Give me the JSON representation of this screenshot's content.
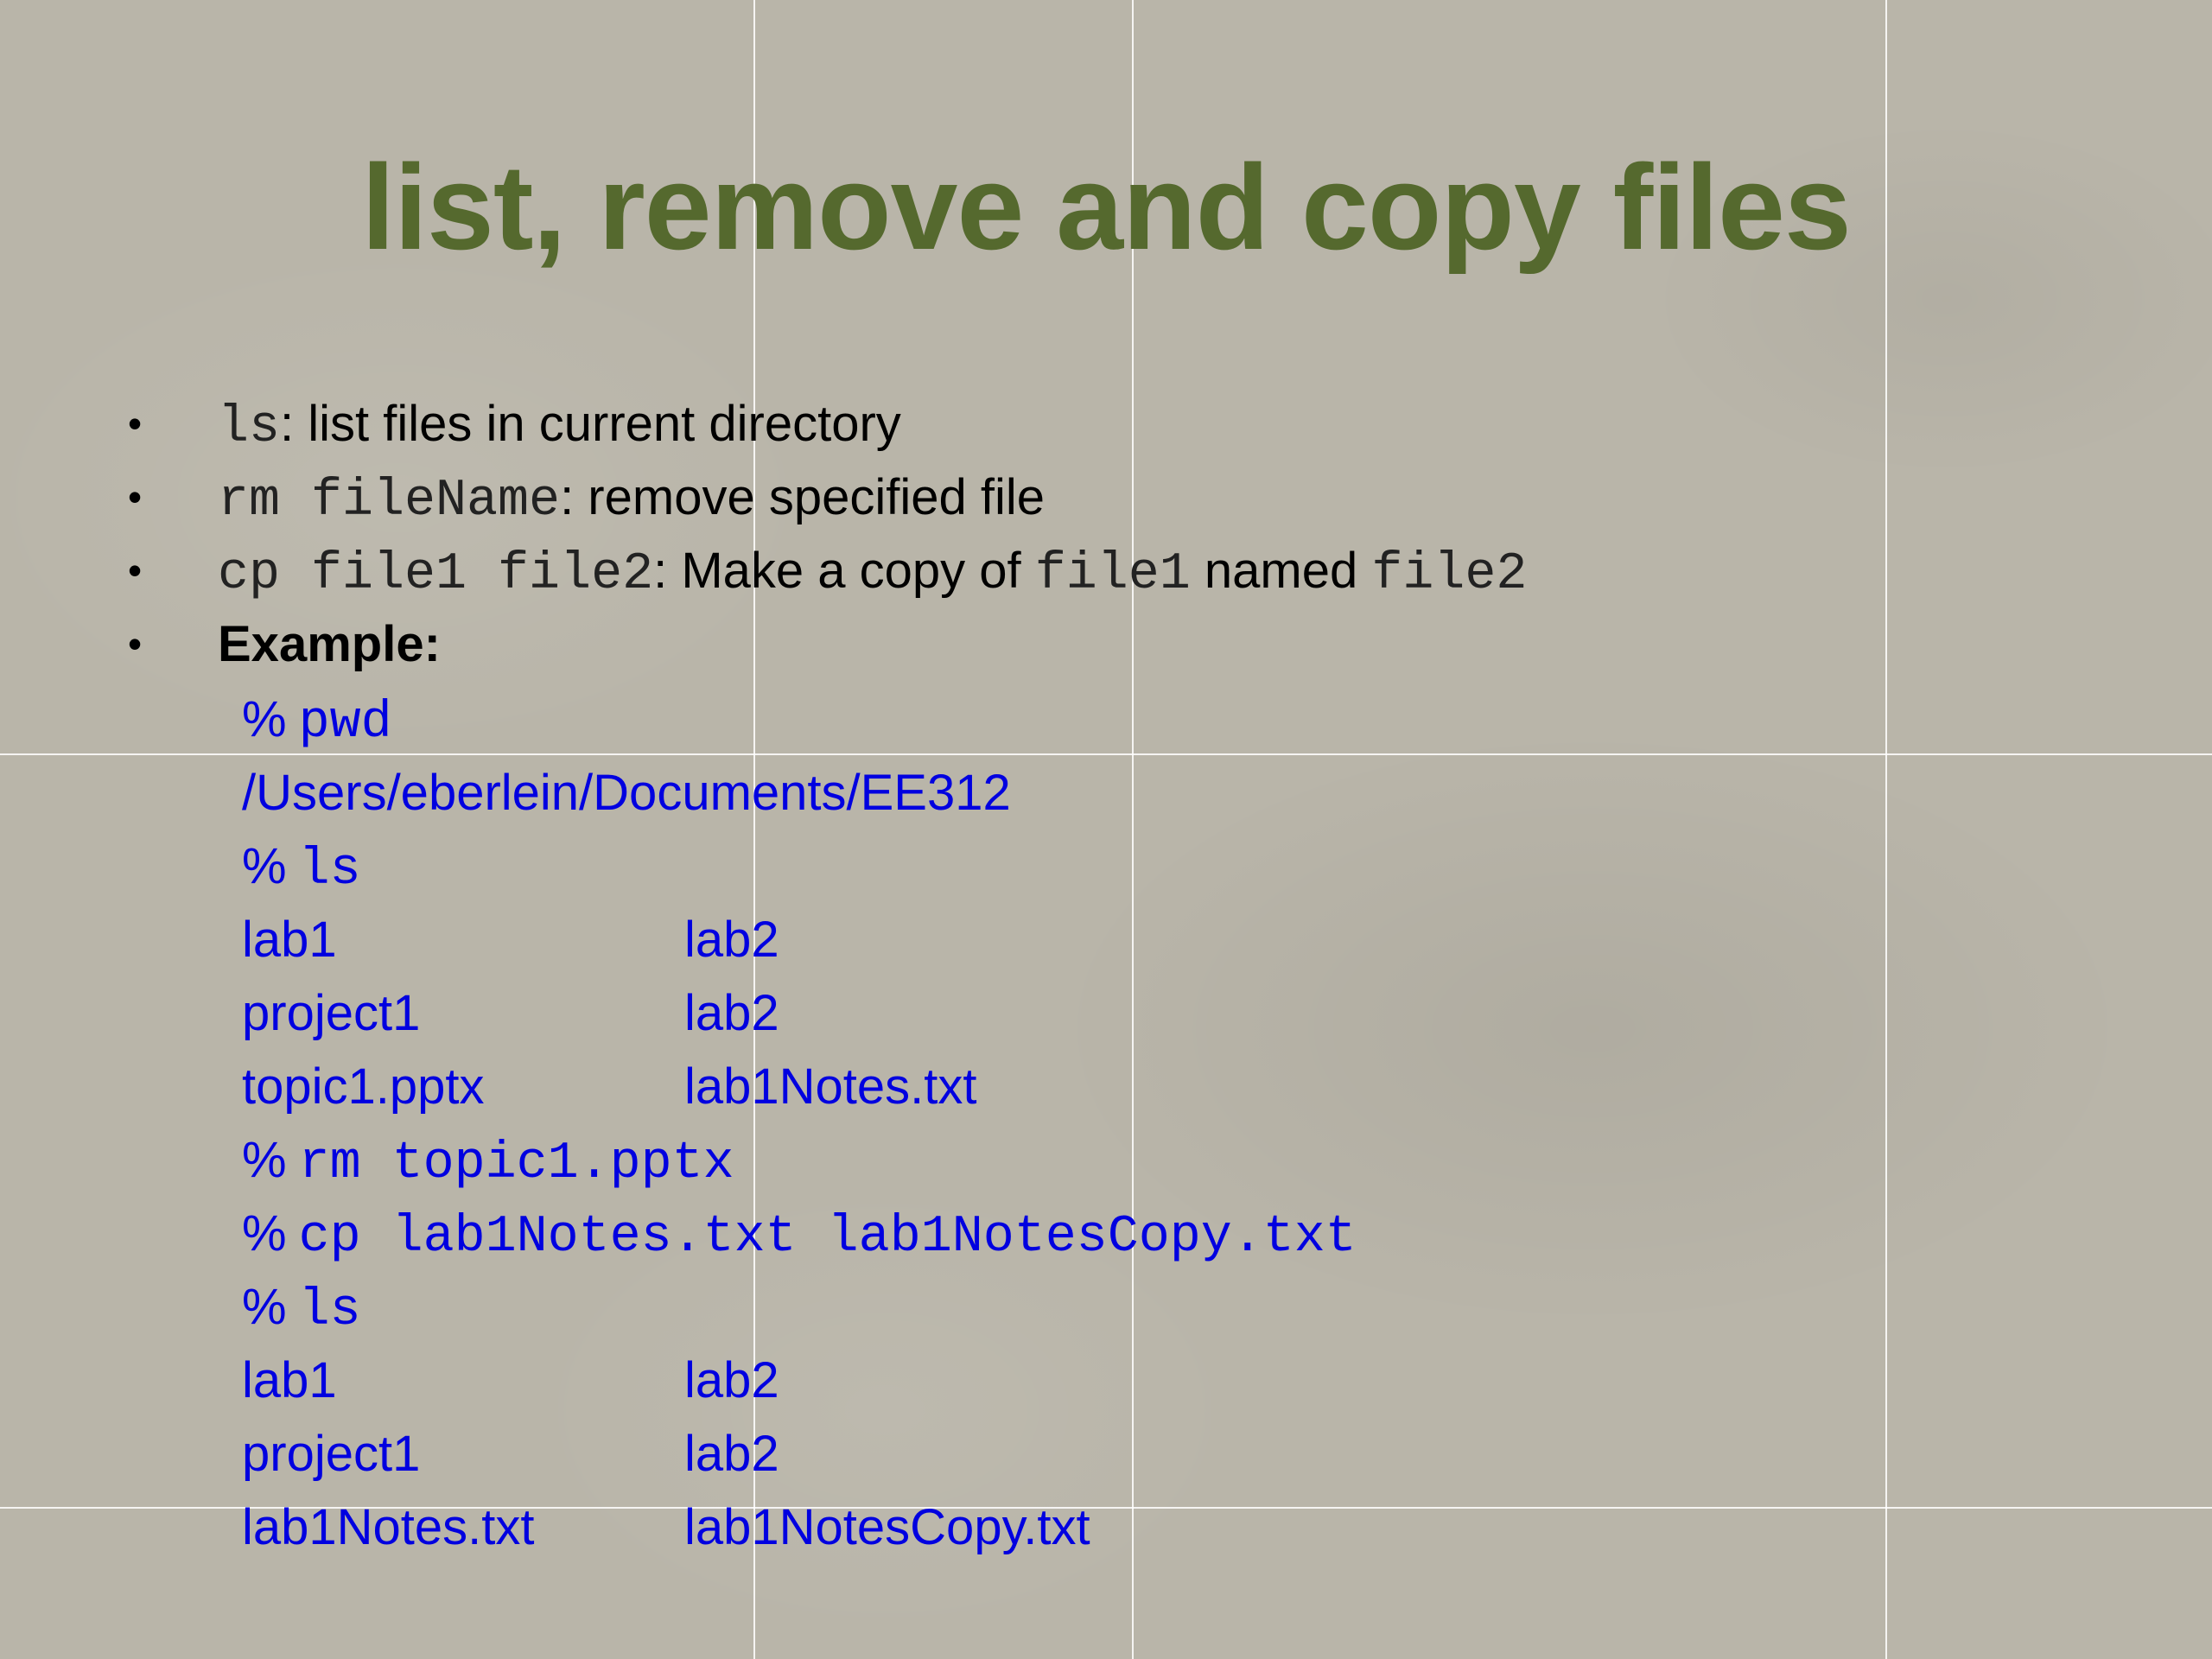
{
  "slide": {
    "title": "list, remove and copy files",
    "bullets": [
      {
        "code": "ls",
        "text": ": list files in current directory"
      },
      {
        "code": "rm fileName",
        "text": ": remove specified file"
      },
      {
        "code": "cp file1 file2",
        "text": ": Make a copy of ",
        "code2": "file1",
        "text2": " named ",
        "code3": "file2"
      },
      {
        "label": "Example:"
      }
    ],
    "example": {
      "prompt": "%",
      "cmd_pwd": "pwd",
      "pwd_output": "/Users/eberlein/Documents/EE312",
      "cmd_ls": "ls",
      "ls1": [
        [
          "lab1",
          "lab2"
        ],
        [
          "project1",
          "lab2"
        ],
        [
          "topic1.pptx",
          "lab1Notes.txt"
        ]
      ],
      "cmd_rm": "rm topic1.pptx",
      "cmd_cp": "cp lab1Notes.txt lab1NotesCopy.txt",
      "cmd_ls2": "ls",
      "ls2": [
        [
          "lab1",
          "lab2"
        ],
        [
          "project1",
          "lab2"
        ],
        [
          "lab1Notes.txt",
          "lab1NotesCopy.txt"
        ]
      ]
    },
    "colors": {
      "title": "#55692e",
      "example_text": "#0000e0",
      "body_text": "#000000",
      "background": "#b9b5a9"
    }
  }
}
